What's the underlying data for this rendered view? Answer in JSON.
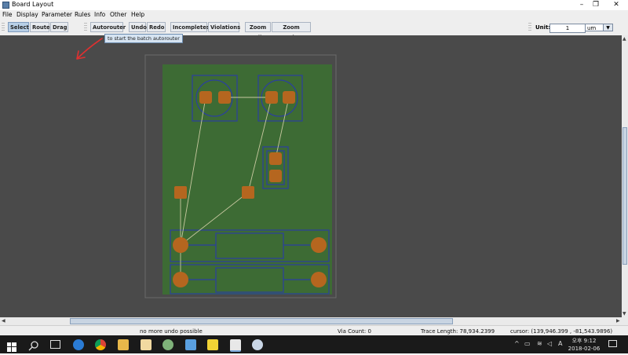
{
  "window": {
    "title": "Board Layout",
    "controls": [
      "–",
      "❐",
      "✕"
    ]
  },
  "menu": [
    "File",
    "Display",
    "Parameter",
    "Rules",
    "Info",
    "Other",
    "Help"
  ],
  "toolbar": {
    "select": "Select",
    "route": "Route",
    "drag": "Drag",
    "autorouter": "Autorouter",
    "undo": "Undo",
    "redo": "Redo",
    "incompletes": "Incompletes",
    "violations": "Violations",
    "zoom_all": "Zoom All",
    "zoom_region": "Zoom Region",
    "unit_label": "Unit:",
    "unit_value": "1",
    "unit_select": "um"
  },
  "tooltip": "to start the batch autorouter",
  "status": {
    "message": "no more undo possible",
    "via_count": "Via Count: 0",
    "trace_length": "Trace Length: 78,934.2399",
    "cursor": "cursor:  (139,946.399 , -81,543.9896)"
  },
  "taskbar": {
    "time": "오후 9:12",
    "date": "2018-02-06",
    "ime": "A"
  },
  "colors": {
    "board": "#3d6b34",
    "pad": "#b5661f",
    "outline": "#2b3fa0",
    "ratsnest": "#c8c8a0",
    "canvas": "#4a4a4a",
    "annotation": "#e03030"
  }
}
